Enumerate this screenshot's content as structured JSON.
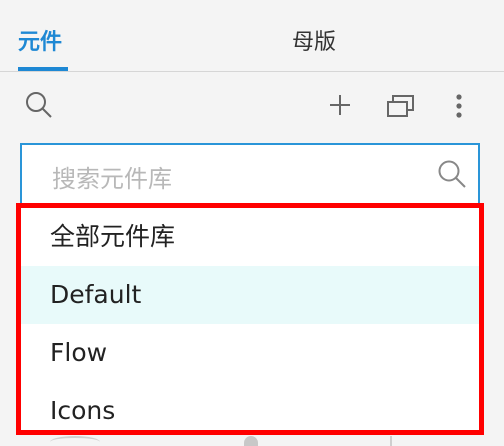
{
  "tabs": {
    "components": "元件",
    "masters": "母版"
  },
  "search": {
    "placeholder": "搜索元件库"
  },
  "dropdown": {
    "options": [
      {
        "label": "全部元件库",
        "highlighted": false
      },
      {
        "label": "Default",
        "highlighted": true
      },
      {
        "label": "Flow",
        "highlighted": false
      },
      {
        "label": "Icons",
        "highlighted": false
      }
    ]
  },
  "colors": {
    "accent": "#1e88d4",
    "highlight_bg": "#e8fafa",
    "annotation_border": "#ff0000"
  },
  "icons": {
    "toolbar": [
      "search-icon",
      "plus-icon",
      "duplicate-icon",
      "more-vertical-icon"
    ],
    "search_field": "search-icon"
  }
}
